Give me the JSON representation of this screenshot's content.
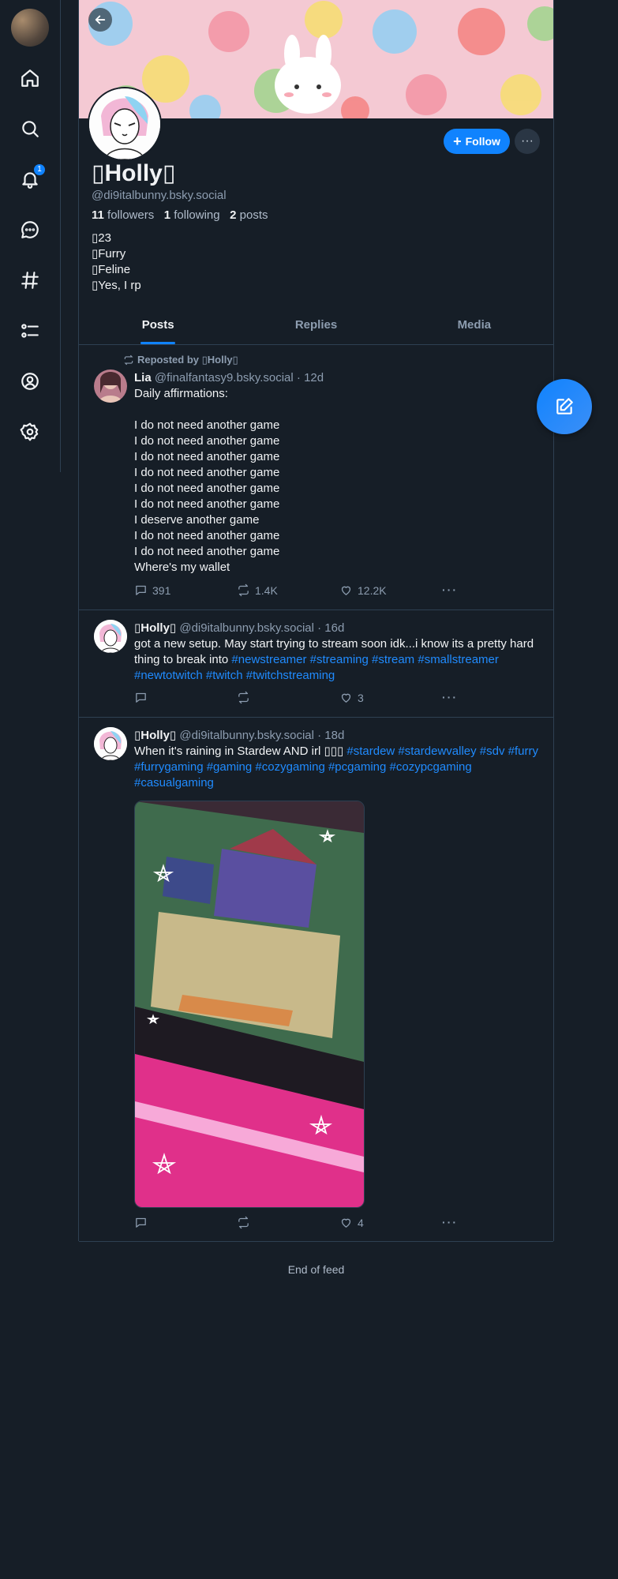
{
  "nav": {
    "notifications_badge": "1",
    "items": [
      "home-icon",
      "search-icon",
      "bell-icon",
      "chat-icon",
      "hash-icon",
      "list-icon",
      "profile-icon",
      "settings-icon"
    ]
  },
  "profile": {
    "name": "▯Holly▯",
    "handle": "@di9italbunny.bsky.social",
    "followers_count": "11",
    "followers_label": "followers",
    "following_count": "1",
    "following_label": "following",
    "posts_count": "2",
    "posts_label": "posts",
    "bio": [
      "▯23",
      "▯Furry",
      "▯Feline",
      "▯Yes, I rp"
    ],
    "follow_label": "Follow",
    "more_label": "···"
  },
  "tabs": [
    "Posts",
    "Replies",
    "Media"
  ],
  "feed": [
    {
      "reposted_by": "Reposted by ▯Holly▯",
      "author": "Lia",
      "handle": "@finalfantasy9.bsky.social",
      "age": "· 12d",
      "text": "Daily affirmations:\n\nI do not need another game\nI do not need another game\nI do not need another game\nI do not need another game\nI do not need another game\nI do not need another game\nI deserve another game\nI do not need another game\nI do not need another game\nWhere's my wallet",
      "replies": "391",
      "reposts": "1.4K",
      "likes": "12.2K"
    },
    {
      "author": "▯Holly▯",
      "handle": "@di9italbunny.bsky.social",
      "age": "· 16d",
      "text_plain": "got a new setup. May start trying to stream soon idk...i know its a pretty hard thing to break into ",
      "tags": "#newstreamer #streaming #stream #smallstreamer #newtotwitch #twitch #twitchstreaming",
      "replies": "",
      "reposts": "",
      "likes": "3"
    },
    {
      "author": "▯Holly▯",
      "handle": "@di9italbunny.bsky.social",
      "age": "· 18d",
      "text_plain": "When it's raining in Stardew AND irl ▯▯▯ ",
      "tags": "#stardew #stardewvalley #sdv #furry #furrygaming #gaming #cozygaming #pcgaming #cozypcgaming #casualgaming",
      "replies": "",
      "reposts": "",
      "likes": "4"
    }
  ],
  "end_of_feed": "End of feed",
  "colors": {
    "accent": "#1083fe",
    "background": "#161e27",
    "border": "#2e4052"
  }
}
